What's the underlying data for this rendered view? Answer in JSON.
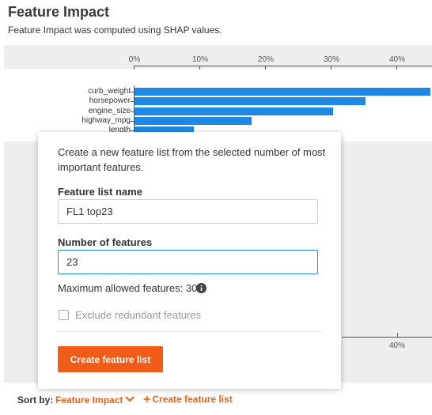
{
  "header": {
    "title": "Feature Impact",
    "subtitle": "Feature Impact was computed using SHAP values."
  },
  "chart_data": {
    "type": "bar",
    "orientation": "horizontal",
    "x_tick_labels": [
      "0%",
      "10%",
      "20%",
      "30%",
      "40%"
    ],
    "xlim": [
      0,
      45
    ],
    "categories": [
      "curb_weight",
      "horsepower",
      "engine_size",
      "highway_mpg",
      "length"
    ],
    "values": [
      45,
      35.2,
      30.3,
      17.8,
      9
    ]
  },
  "bottom_axis_label": "40%",
  "popover": {
    "description": "Create a new feature list from the selected number of most important features.",
    "name_label": "Feature list name",
    "name_value": "FL1 top23",
    "count_label": "Number of features",
    "count_value": "23",
    "max_text": "Maximum allowed features: 30",
    "exclude_label": "Exclude redundant features",
    "exclude_checked": false,
    "create_button": "Create feature list"
  },
  "sort_bar": {
    "label": "Sort by:",
    "value": "Feature Impact",
    "create_link": "Create feature list"
  },
  "colors": {
    "bar": "#1e88e5",
    "accent": "#e8641e",
    "button": "#f25c19"
  }
}
